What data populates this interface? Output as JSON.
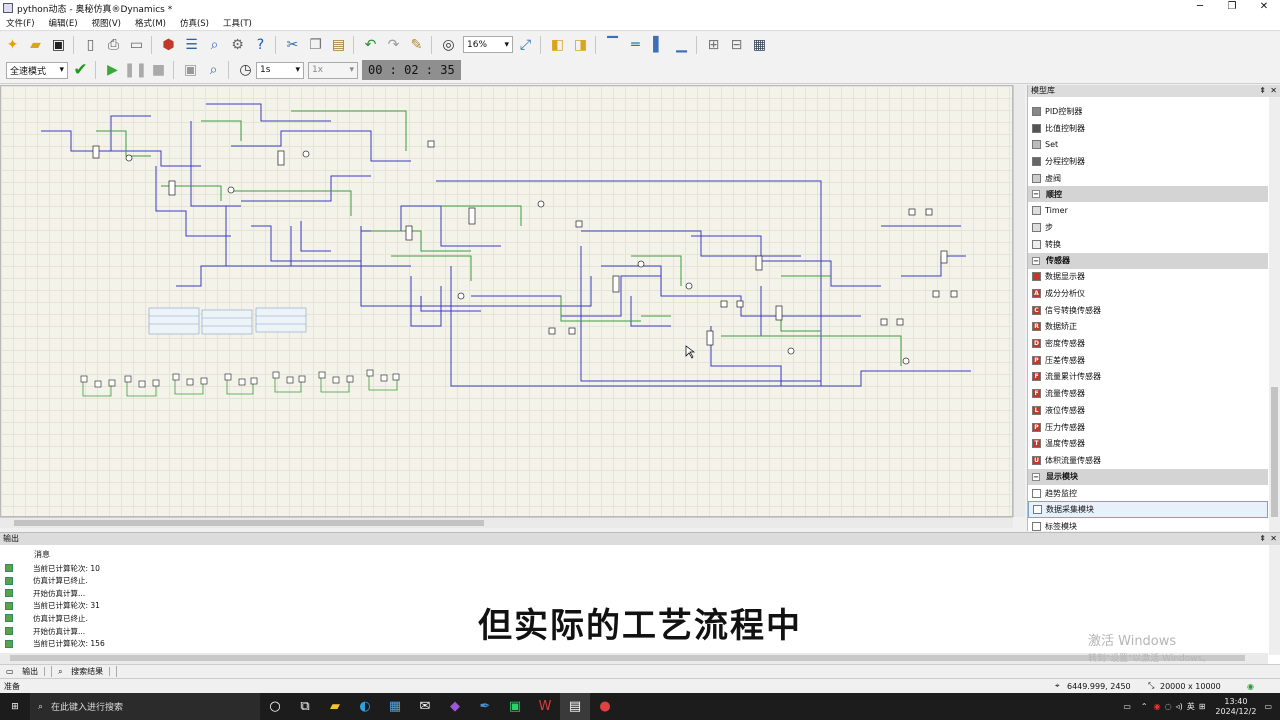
{
  "window": {
    "title": "python动态 - 奥秘仿真®Dynamics *",
    "minimize": "─",
    "restore": "❐",
    "close": "✕"
  },
  "menu": [
    "文件(F)",
    "编辑(E)",
    "视图(V)",
    "格式(M)",
    "仿真(S)",
    "工具(T)"
  ],
  "toolbar": {
    "zoom": "16%",
    "mode": "全速模式",
    "step": "1s",
    "speed": "1x",
    "timer": "00 : 02 : 35"
  },
  "library": {
    "title": "模型库",
    "pin": "⇞",
    "close": "✕",
    "items": [
      {
        "type": "item",
        "label": "PID控制器",
        "icon": "pid-controller-icon",
        "glyph": "",
        "color": "#888888"
      },
      {
        "type": "item",
        "label": "比值控制器",
        "icon": "ratio-controller-icon",
        "glyph": "",
        "color": "#555555"
      },
      {
        "type": "item",
        "label": "Set",
        "icon": "set-icon",
        "glyph": "",
        "color": "#bbbbbb"
      },
      {
        "type": "item",
        "label": "分程控制器",
        "icon": "split-range-controller-icon",
        "glyph": "",
        "color": "#666666"
      },
      {
        "type": "item",
        "label": "虚阀",
        "icon": "virtual-valve-icon",
        "glyph": "",
        "color": "#cccccc"
      },
      {
        "type": "category",
        "label": "顺控"
      },
      {
        "type": "item",
        "label": "Timer",
        "icon": "timer-icon",
        "glyph": "",
        "color": "#dddddd"
      },
      {
        "type": "item",
        "label": "步",
        "icon": "step-icon",
        "glyph": "",
        "color": "#dddddd"
      },
      {
        "type": "item",
        "label": "转换",
        "icon": "transition-icon",
        "glyph": "",
        "color": "#eeeeee"
      },
      {
        "type": "category",
        "label": "传感器"
      },
      {
        "type": "item",
        "label": "数据显示器",
        "icon": "data-display-icon",
        "glyph": "",
        "color": "#c0392b"
      },
      {
        "type": "item",
        "label": "成分分析仪",
        "icon": "composition-analyzer-icon",
        "glyph": "A",
        "color": "#c0392b"
      },
      {
        "type": "item",
        "label": "信号转换传感器",
        "icon": "signal-converter-icon",
        "glyph": "C",
        "color": "#c0392b"
      },
      {
        "type": "item",
        "label": "数据矫正",
        "icon": "data-correction-icon",
        "glyph": "R",
        "color": "#c0392b"
      },
      {
        "type": "item",
        "label": "密度传感器",
        "icon": "density-sensor-icon",
        "glyph": "D",
        "color": "#c0392b"
      },
      {
        "type": "item",
        "label": "压差传感器",
        "icon": "pressure-diff-sensor-icon",
        "glyph": "P",
        "color": "#c0392b"
      },
      {
        "type": "item",
        "label": "流量累计传感器",
        "icon": "flow-totalizer-icon",
        "glyph": "F",
        "color": "#c0392b"
      },
      {
        "type": "item",
        "label": "流量传感器",
        "icon": "flow-sensor-icon",
        "glyph": "F",
        "color": "#c0392b"
      },
      {
        "type": "item",
        "label": "液位传感器",
        "icon": "level-sensor-icon",
        "glyph": "L",
        "color": "#c0392b"
      },
      {
        "type": "item",
        "label": "压力传感器",
        "icon": "pressure-sensor-icon",
        "glyph": "P",
        "color": "#c0392b"
      },
      {
        "type": "item",
        "label": "温度传感器",
        "icon": "temperature-sensor-icon",
        "glyph": "T",
        "color": "#c0392b"
      },
      {
        "type": "item",
        "label": "体积流量传感器",
        "icon": "volume-flow-sensor-icon",
        "glyph": "U",
        "color": "#c0392b"
      },
      {
        "type": "category",
        "label": "显示模块"
      },
      {
        "type": "item",
        "label": "趋势监控",
        "icon": "trend-monitor-icon",
        "glyph": "",
        "color": "#ffffff"
      },
      {
        "type": "item",
        "label": "数据采集模块",
        "icon": "data-acquisition-icon",
        "glyph": "",
        "color": "#ffffff",
        "selected": true
      },
      {
        "type": "item",
        "label": "标签模块",
        "icon": "label-module-icon",
        "glyph": "",
        "color": "#ffffff"
      }
    ]
  },
  "output": {
    "title": "输出",
    "pin": "⇞",
    "close": "✕",
    "header": "消息",
    "rows": [
      "当前已计算轮次: 10",
      "仿真计算已终止.",
      "开始仿真计算...",
      "当前已计算轮次: 31",
      "仿真计算已终止.",
      "开始仿真计算...",
      "当前已计算轮次: 156"
    ]
  },
  "tabs": [
    "输出",
    "搜索结果"
  ],
  "status": {
    "left": "准备",
    "coords": "6449.999, 2450",
    "size": "20000 x 10000"
  },
  "subtitle": "但实际的工艺流程中",
  "watermark": {
    "line1": "激活 Windows",
    "line2": "转到\"设置\"以激活 Windows。"
  },
  "taskbar": {
    "search_placeholder": "在此键入进行搜索",
    "ime": "英",
    "time": "13:40",
    "date": "2024/12/2"
  },
  "colors": {
    "pipe_blue": "#3a3ac4",
    "pipe_green": "#3d9a3d",
    "canvas": "#f4f3ea",
    "accent": "#7da2ce"
  }
}
